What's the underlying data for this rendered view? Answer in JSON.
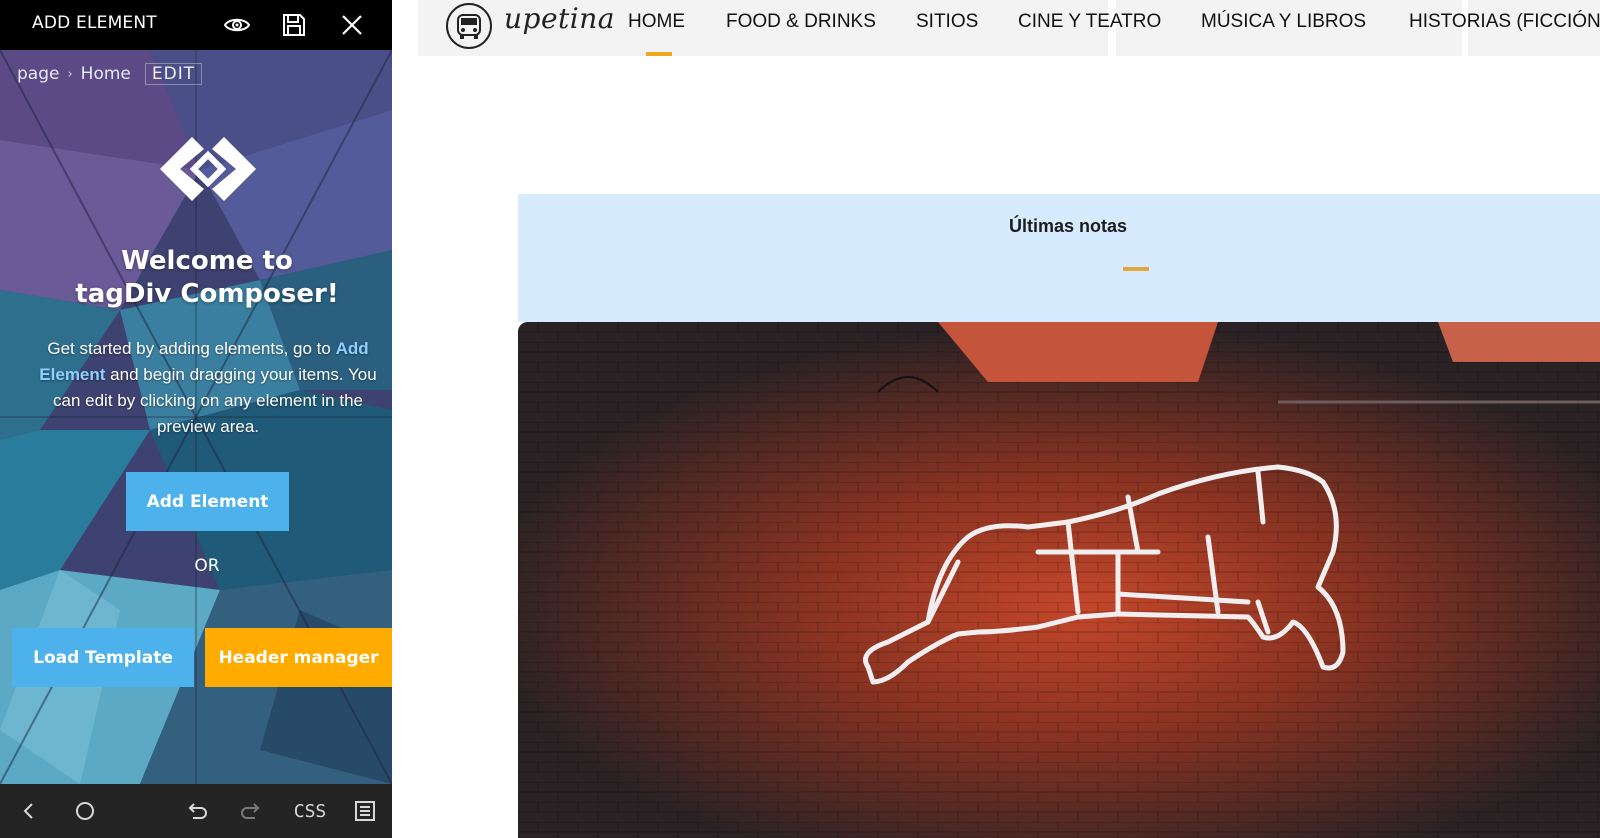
{
  "panel": {
    "topbar": {
      "title": "ADD ELEMENT",
      "icons": [
        "eye-icon",
        "save-icon",
        "close-icon"
      ]
    },
    "breadcrumb": {
      "items": [
        "page",
        "Home"
      ],
      "edit_label": "EDIT"
    },
    "welcome": {
      "line1": "Welcome to",
      "line2": "tagDiv Composer!"
    },
    "description": {
      "before": "Get started by adding elements, go to",
      "link": "Add Element",
      "after": "and begin dragging your items. You can edit by clicking on any element in the preview area."
    },
    "buttons": {
      "add_element": "Add Element",
      "or": "OR",
      "load_template": "Load Template",
      "header_manager": "Header manager"
    },
    "bottombar": {
      "icons": [
        "back-icon",
        "circle-icon",
        "undo-icon",
        "redo-icon",
        "css-icon",
        "menu-icon"
      ],
      "css_label": "CSS"
    }
  },
  "site": {
    "name": "upetina",
    "nav": [
      "HOME",
      "FOOD & DRINKS",
      "SITIOS",
      "CINE Y TEATRO",
      "MÚSICA Y LIBROS",
      "HISTORIAS (FICCIÓN"
    ],
    "active_index": 0,
    "section_title": "Últimas notas"
  },
  "colors": {
    "accent_blue": "#4db2ec",
    "accent_orange": "#ffab00",
    "nav_active": "#f0a81e",
    "band_bg": "#d6ebfd"
  }
}
